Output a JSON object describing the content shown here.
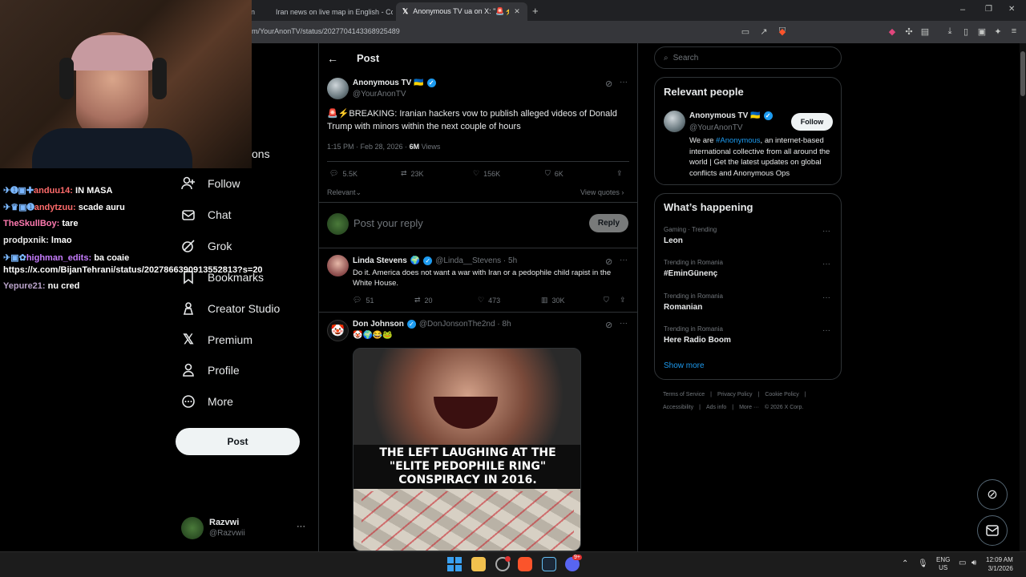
{
  "browser": {
    "tabs": [
      {
        "label": "on"
      },
      {
        "label": "Iran news on live map in English - Co"
      },
      {
        "label": "Anonymous TV ua on X: \"🚨⚡ B"
      }
    ],
    "url": "m/YourAnonTV/status/2027704143368925489"
  },
  "stream_chat": [
    {
      "user": "",
      "text": ""
    },
    {
      "user": "anduu14:",
      "text": "IN MASA",
      "color": "#ff6b6b"
    },
    {
      "user": "andytzuu:",
      "text": "scade auru",
      "color": "#ff6b6b"
    },
    {
      "user": "TheSkullBoy:",
      "text": "tare",
      "color": "#ff7ab0"
    },
    {
      "user": "prodpxnik:",
      "text": "lmao",
      "color": "#e8e8e8"
    },
    {
      "user": "highman_edits:",
      "text": "ba coaie",
      "color": "#c77dff"
    },
    {
      "user": "",
      "text": "https://x.com/BijanTehrani/status/2027866390913552813?s=20",
      "color": "#ffffff"
    },
    {
      "user": "Yepure21:",
      "text": "nu cred",
      "color": "#b9a3c9"
    }
  ],
  "nav": {
    "partial": "ons",
    "items": [
      "Follow",
      "Chat",
      "Grok",
      "Bookmarks",
      "Creator Studio",
      "Premium",
      "Profile",
      "More"
    ],
    "post_button": "Post",
    "account_name": "Razvwi",
    "account_handle": "@Razvwii",
    "account_more": "···"
  },
  "header": {
    "title": "Post"
  },
  "main_post": {
    "author": "Anonymous TV 🇺🇦",
    "handle": "@YourAnonTV",
    "text": "🚨⚡BREAKING: Iranian hackers vow to publish alleged videos of Donald Trump with minors within the next couple of hours",
    "time": "1:15 PM · Feb 28, 2026 · ",
    "views_count": "6M",
    "views_label": " Views",
    "replies": "5.5K",
    "reposts": "23K",
    "likes": "156K",
    "bookmarks": "6K",
    "sort": "Relevant",
    "view_quotes": "View quotes"
  },
  "reply_box": {
    "placeholder": "Post your reply",
    "button": "Reply"
  },
  "replies": [
    {
      "author": "Linda Stevens",
      "handle": "@Linda__Stevens · 5h",
      "text": "Do it. America does not want a war with Iran or a pedophile child rapist in the White House.",
      "replies": "51",
      "reposts": "20",
      "likes": "473",
      "views": "30K"
    },
    {
      "author": "Don Johnson",
      "handle": "@DonJonsonThe2nd · 8h",
      "text": "🤡🌍😂🐸",
      "meme_caption": "THE LEFT LAUGHING AT THE \"ELITE PEDOPHILE RING\" CONSPIRACY IN 2016."
    }
  ],
  "search": {
    "placeholder": "Search"
  },
  "relevant_people": {
    "title": "Relevant people",
    "name": "Anonymous TV 🇺🇦",
    "handle": "@YourAnonTV",
    "follow": "Follow",
    "bio_prefix": "We are ",
    "bio_link": "#Anonymous",
    "bio_rest": ", an internet-based international collective from all around the world | Get the latest updates on global conflicts and Anonymous Ops"
  },
  "whats_happening": {
    "title": "What’s happening",
    "trends": [
      {
        "context": "Gaming · Trending",
        "title": "Leon"
      },
      {
        "context": "Trending in Romania",
        "title": "#EminGünenç"
      },
      {
        "context": "Trending in Romania",
        "title": "Romanian"
      },
      {
        "context": "Trending in Romania",
        "title": "Here Radio Boom"
      }
    ],
    "show_more": "Show more"
  },
  "footer_links": [
    "Terms of Service",
    "Privacy Policy",
    "Cookie Policy",
    "Accessibility",
    "Ads info",
    "More ···",
    "© 2026 X Corp."
  ],
  "taskbar": {
    "lang": "ENG",
    "region": "US",
    "time": "12:09 AM",
    "date": "3/1/2026",
    "badge": "9+"
  },
  "colors": {
    "accent": "#1d9bf0",
    "bg": "#000000"
  }
}
